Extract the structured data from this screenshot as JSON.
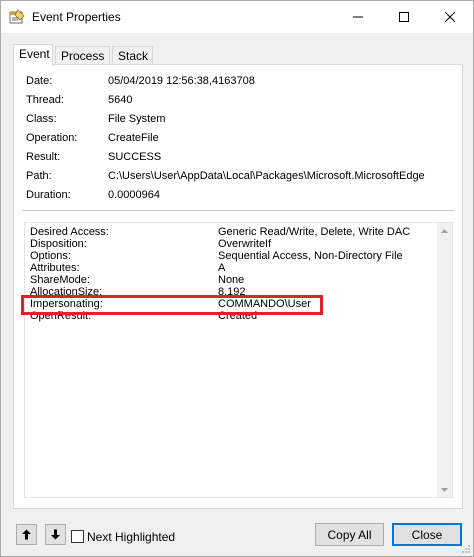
{
  "window": {
    "title": "Event Properties",
    "icon": "event-properties-icon"
  },
  "tabs": [
    {
      "label": "Event",
      "active": true
    },
    {
      "label": "Process",
      "active": false
    },
    {
      "label": "Stack",
      "active": false
    }
  ],
  "properties": [
    {
      "label": "Date:",
      "value": "05/04/2019 12:56:38,4163708"
    },
    {
      "label": "Thread:",
      "value": "5640"
    },
    {
      "label": "Class:",
      "value": "File System"
    },
    {
      "label": "Operation:",
      "value": "CreateFile"
    },
    {
      "label": "Result:",
      "value": "SUCCESS"
    },
    {
      "label": "Path:",
      "value": "C:\\Users\\User\\AppData\\Local\\Packages\\Microsoft.MicrosoftEdge"
    },
    {
      "label": "Duration:",
      "value": "0.0000964"
    }
  ],
  "details": [
    {
      "label": "Desired Access:",
      "value": "Generic Read/Write, Delete, Write DAC"
    },
    {
      "label": "Disposition:",
      "value": "OverwriteIf"
    },
    {
      "label": "Options:",
      "value": "Sequential Access, Non-Directory File"
    },
    {
      "label": "Attributes:",
      "value": "A"
    },
    {
      "label": "ShareMode:",
      "value": "None"
    },
    {
      "label": "AllocationSize:",
      "value": "8,192"
    },
    {
      "label": "Impersonating:",
      "value": "COMMANDO\\User"
    },
    {
      "label": "OpenResult:",
      "value": "Created"
    }
  ],
  "highlight_color": "#e0202a",
  "footer": {
    "next_highlighted_label": "Next Highlighted",
    "copy_all_label": "Copy All",
    "close_label": "Close"
  }
}
